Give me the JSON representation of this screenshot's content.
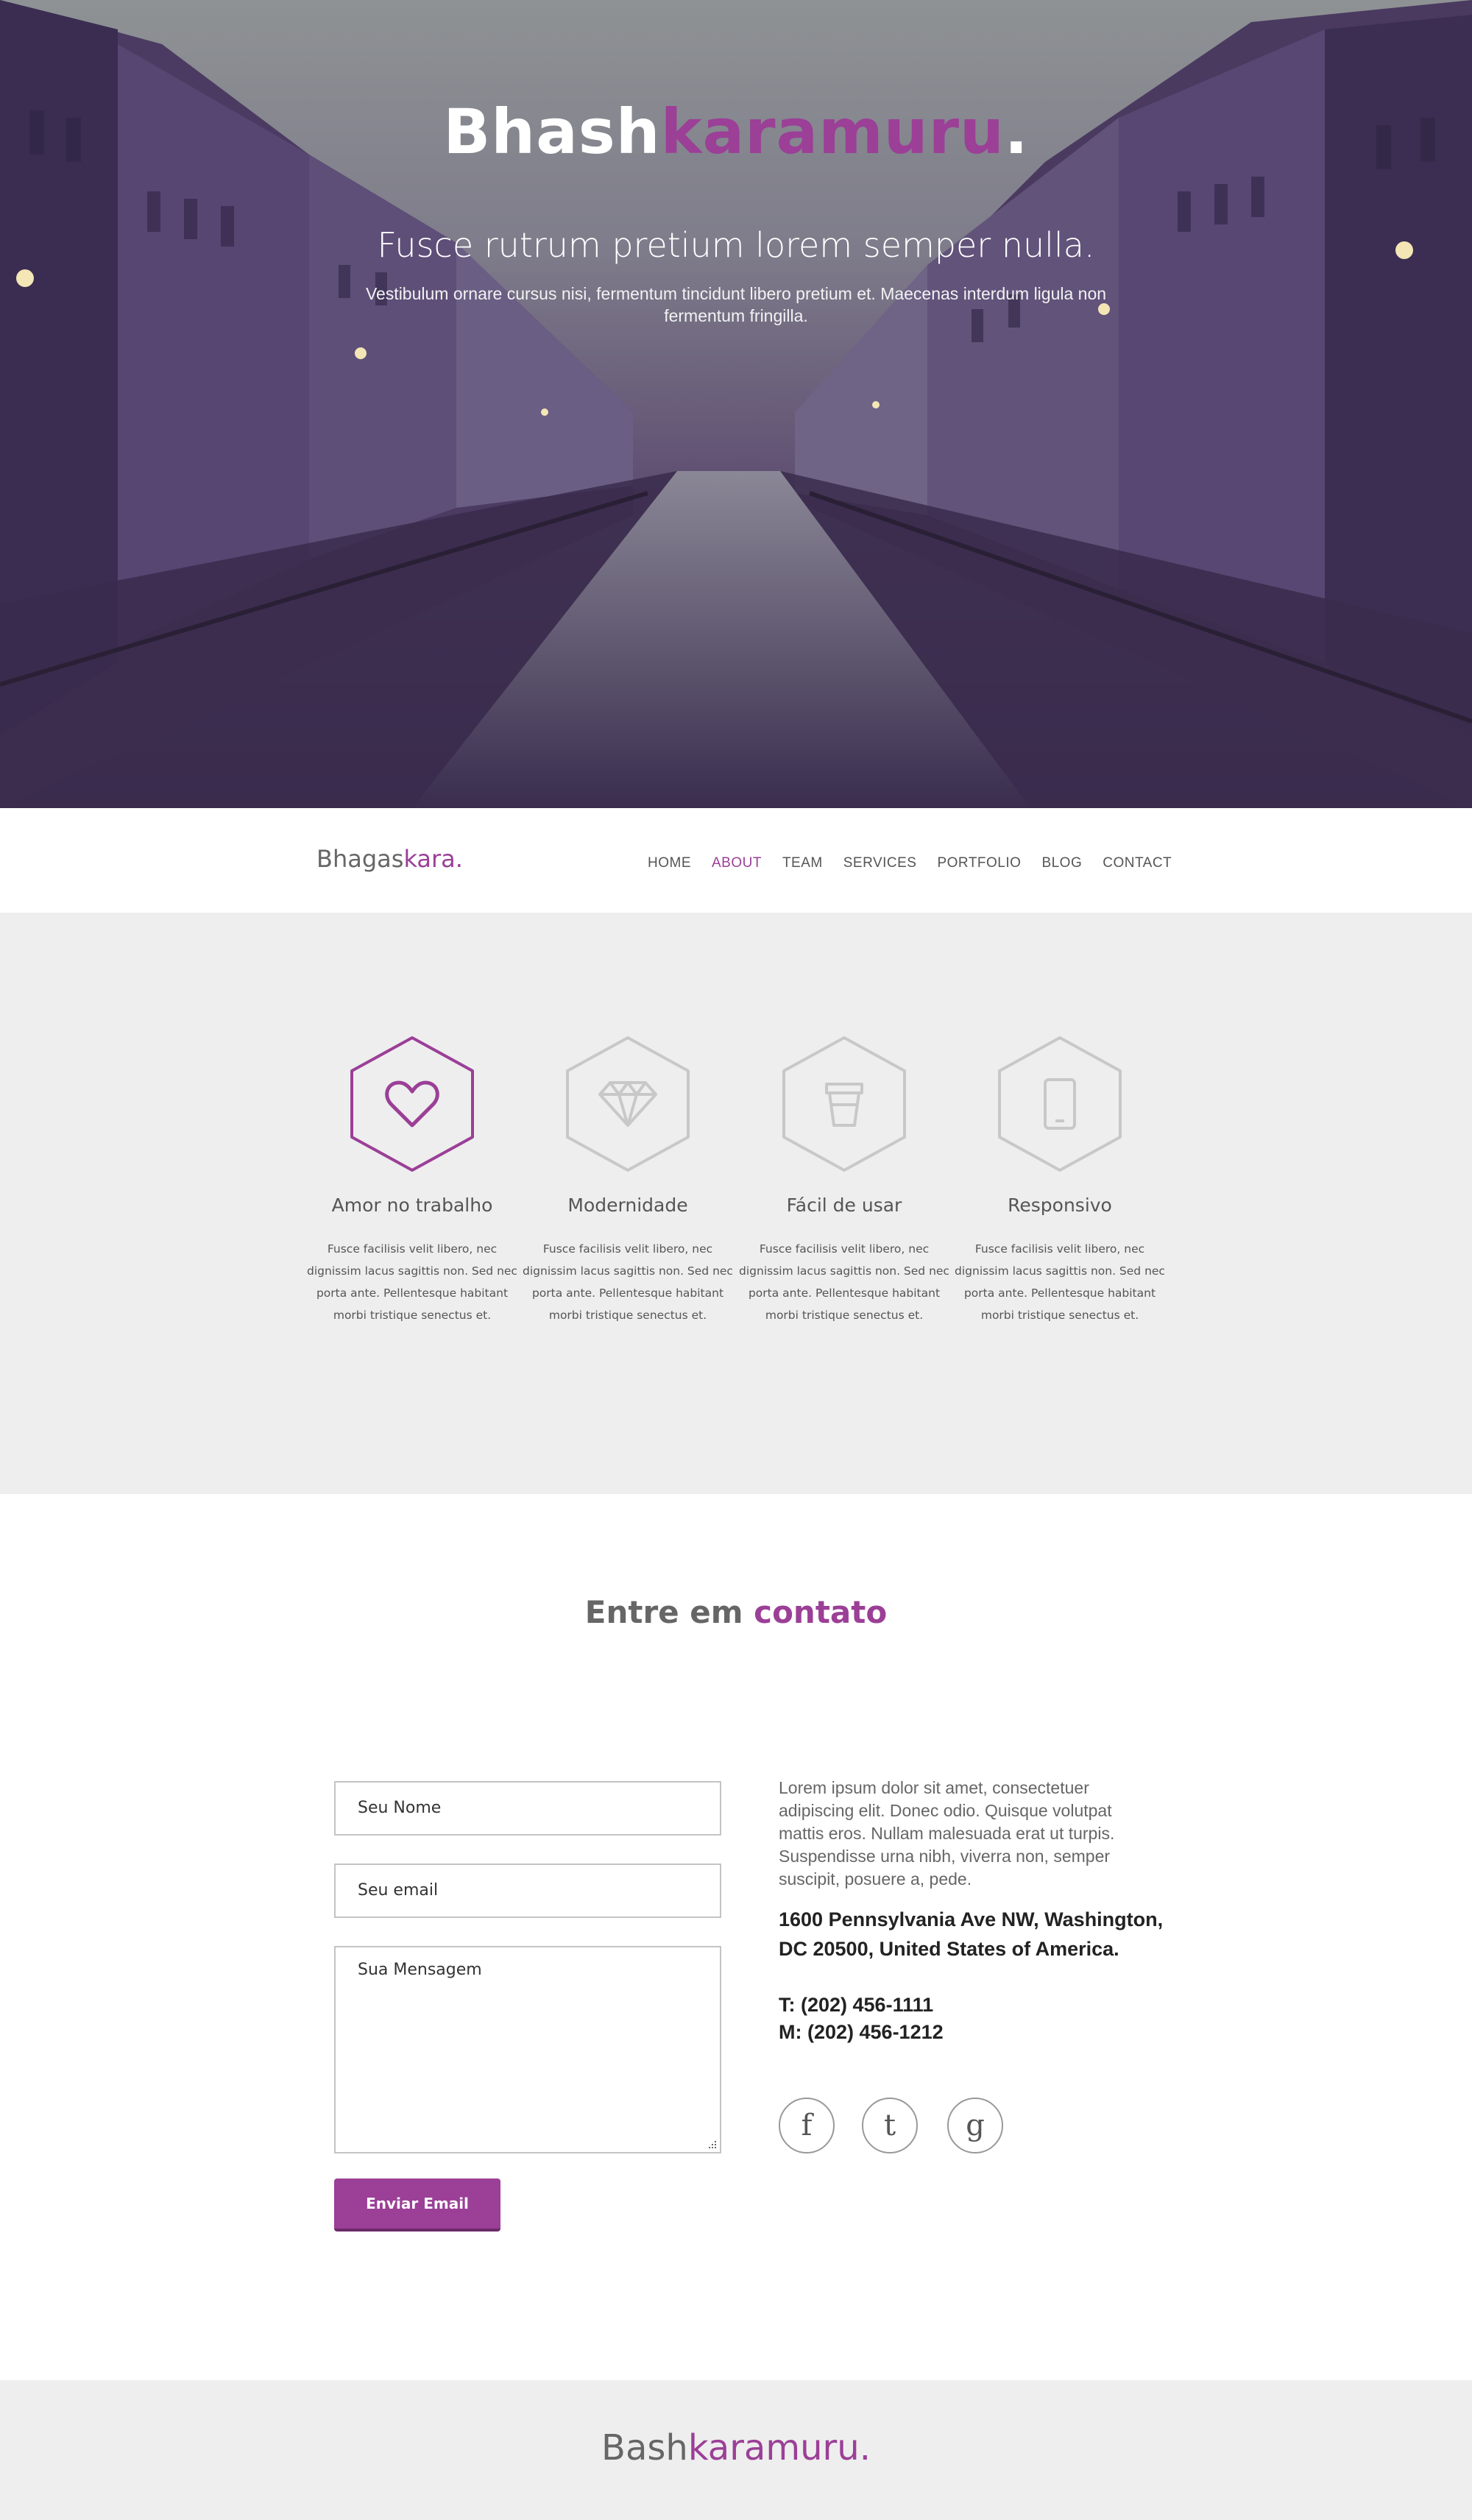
{
  "hero": {
    "title_white": "Bhash",
    "title_purple": "karamuru",
    "title_dot": ".",
    "subtitle": "Fusce rutrum pretium lorem semper nulla.",
    "description": "Vestibulum ornare cursus nisi, fermentum tincidunt libero pretium et. Maecenas interdum ligula non fermentum fringilla."
  },
  "nav": {
    "logo_gray": "Bhagas",
    "logo_purple": "kara",
    "logo_dot": ".",
    "links": [
      "HOME",
      "ABOUT",
      "TEAM",
      "SERVICES",
      "PORTFOLIO",
      "BLOG",
      "CONTACT"
    ],
    "active": "ABOUT"
  },
  "features": [
    {
      "icon": "heart-icon",
      "title": "Amor no trabalho",
      "text": "Fusce facilisis velit libero, nec dignissim lacus sagittis non. Sed nec porta ante. Pellentesque habitant morbi tristique senectus et.",
      "highlight": true
    },
    {
      "icon": "diamond-icon",
      "title": "Modernidade",
      "text": "Fusce facilisis velit libero, nec dignissim lacus sagittis non. Sed nec porta ante. Pellentesque habitant morbi tristique senectus et.",
      "highlight": false
    },
    {
      "icon": "cup-icon",
      "title": "Fácil de usar",
      "text": "Fusce facilisis velit libero, nec dignissim lacus sagittis non. Sed nec porta ante. Pellentesque habitant morbi tristique senectus et.",
      "highlight": false
    },
    {
      "icon": "phone-icon",
      "title": "Responsivo",
      "text": "Fusce facilisis velit libero, nec dignissim lacus sagittis non. Sed nec porta ante. Pellentesque habitant morbi tristique senectus et.",
      "highlight": false
    }
  ],
  "contact": {
    "title_gray": "Entre em",
    "title_purple": "contato",
    "name_placeholder": "Seu Nome",
    "email_placeholder": "Seu email",
    "message_placeholder": "Sua Mensagem",
    "send_label": "Enviar Email",
    "info_text": "Lorem ipsum dolor sit amet, consectetuer adipiscing elit. Donec odio. Quisque volutpat mattis eros. Nullam malesuada erat ut turpis. Suspendisse urna nibh, viverra non, semper suscipit, posuere a, pede.",
    "address_line1": "1600 Pennsylvania Ave NW, Washington,",
    "address_line2": "DC 20500, United States of America.",
    "phone_t": "T: (202) 456-1111",
    "phone_m": "M: (202) 456-1212",
    "social": [
      {
        "icon": "facebook-icon",
        "glyph": "f"
      },
      {
        "icon": "twitter-icon",
        "glyph": "t"
      },
      {
        "icon": "google-icon",
        "glyph": "g"
      }
    ]
  },
  "footer": {
    "logo_gray": "Bash",
    "logo_purple": "karamuru",
    "logo_dot": "."
  },
  "colors": {
    "accent": "#9b3f97",
    "section_bg": "#eeeeee",
    "icon_inactive": "#c8c8c8"
  }
}
